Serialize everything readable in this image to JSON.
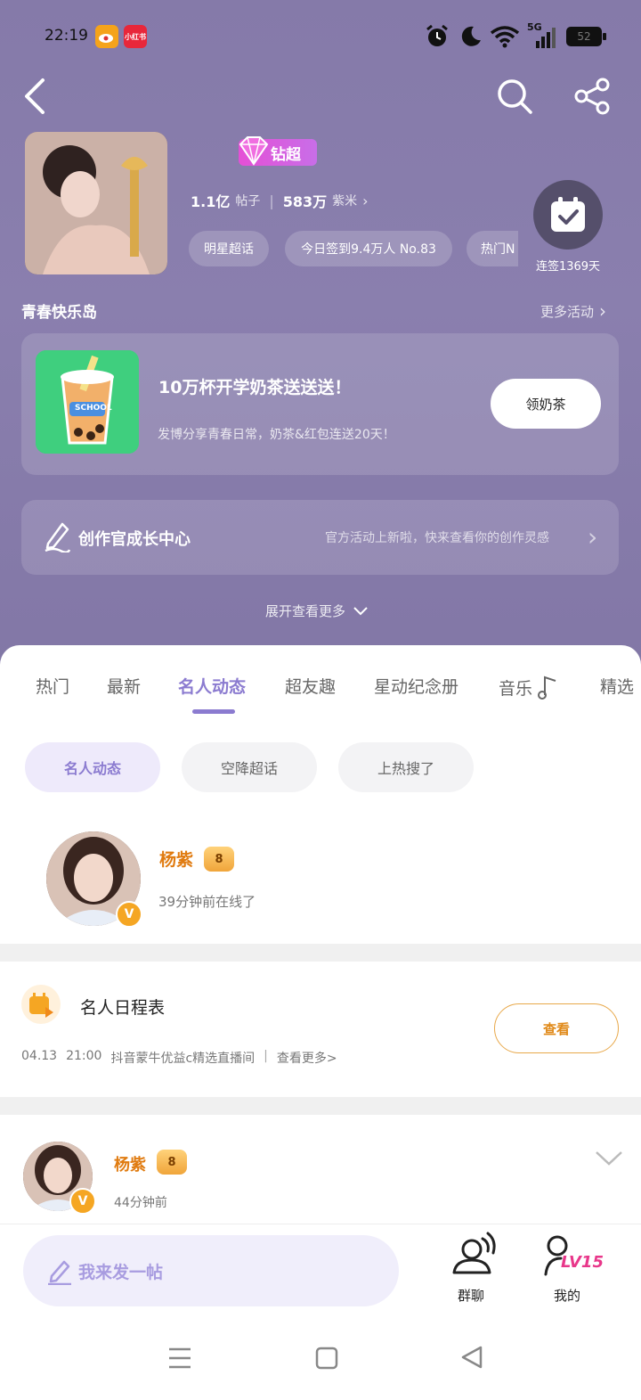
{
  "status_bar": {
    "time": "22:19",
    "app_badges": [
      "weibo",
      "小红书"
    ],
    "network": "5G",
    "battery": "52"
  },
  "header": {
    "back_icon": "chevron-left-icon",
    "search_icon": "search-icon",
    "share_icon": "share-icon"
  },
  "supertopic": {
    "level_badge": "钻超",
    "posts_count": "1.1亿",
    "posts_label": "帖子",
    "fans_count": "583万",
    "fans_label": "紫米",
    "chips": [
      "明星超话",
      "今日签到9.4万人  No.83",
      "热门N"
    ],
    "checkin_label": "连签1369天"
  },
  "activity_section": {
    "title": "青春快乐岛",
    "more_label": "更多活动"
  },
  "promo_card": {
    "image_text": "SCHOOL",
    "title": "10万杯开学奶茶送送送！",
    "subtitle": "发博分享青春日常，奶茶&红包连送20天！",
    "button_label": "领奶茶"
  },
  "creator_card": {
    "title": "创作官成长中心",
    "hint": "官方活动上新啦，快来查看你的创作灵感"
  },
  "expand_label": "展开查看更多",
  "tabs": [
    "热门",
    "最新",
    "名人动态",
    "超友趣",
    "星动纪念册",
    "音乐",
    "精选"
  ],
  "active_tab": "名人动态",
  "sub_pills": [
    "名人动态",
    "空降超话",
    "上热搜了"
  ],
  "celebrity": {
    "name": "杨紫",
    "status": "39分钟前在线了",
    "v_badge": "V",
    "crown_label": "8"
  },
  "schedule": {
    "title": "名人日程表",
    "date": "04.13",
    "time": "21:00",
    "event": "抖音蒙牛优益c精选直播间",
    "more": "查看更多>",
    "button_label": "查看"
  },
  "post": {
    "name": "杨紫",
    "time": "44分钟前",
    "v_badge": "V",
    "crown_label": "8"
  },
  "bottom": {
    "post_placeholder": "我来发一帖",
    "group_chat": "群聊",
    "mine": "我的",
    "level": "LV15"
  },
  "colors": {
    "hero_purple": "#857aa9",
    "accent_purple": "#8b7bd0",
    "name_orange": "#e07b10",
    "button_orange_border": "#e8a84a"
  }
}
